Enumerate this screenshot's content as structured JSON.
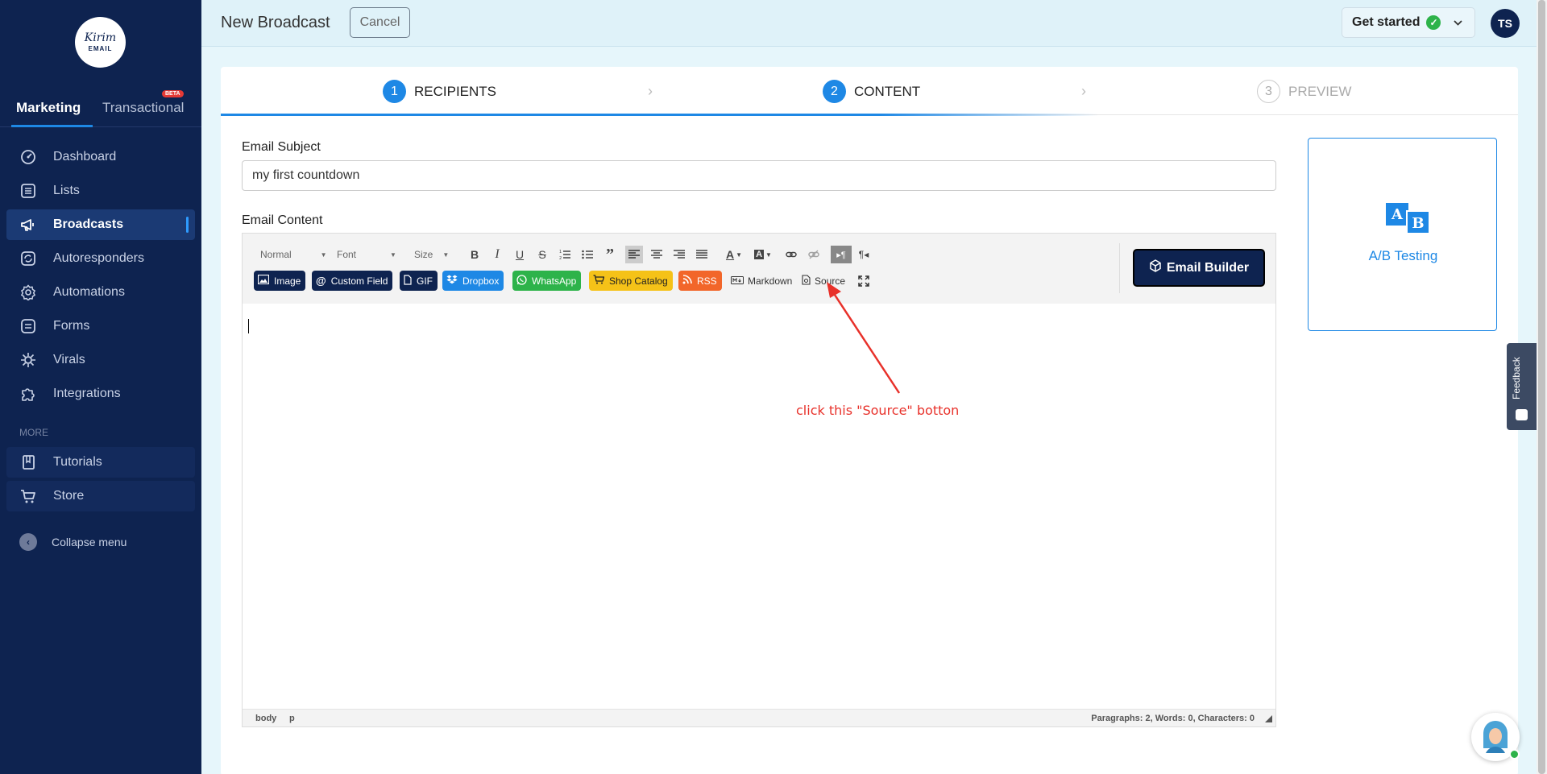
{
  "app": {
    "logo_line1": "Kirim",
    "logo_line2": "EMAIL"
  },
  "sidebar": {
    "tab_marketing": "Marketing",
    "tab_transactional": "Transactional",
    "beta_badge": "BETA",
    "items": [
      {
        "label": "Dashboard",
        "icon": "dashboard-icon"
      },
      {
        "label": "Lists",
        "icon": "list-icon"
      },
      {
        "label": "Broadcasts",
        "icon": "megaphone-icon"
      },
      {
        "label": "Autoresponders",
        "icon": "autoresponder-icon"
      },
      {
        "label": "Automations",
        "icon": "gear-icon"
      },
      {
        "label": "Forms",
        "icon": "form-icon"
      },
      {
        "label": "Virals",
        "icon": "virus-icon"
      },
      {
        "label": "Integrations",
        "icon": "puzzle-icon"
      }
    ],
    "more_label": "MORE",
    "more_items": [
      {
        "label": "Tutorials",
        "icon": "book-icon"
      },
      {
        "label": "Store",
        "icon": "cart-icon"
      }
    ],
    "collapse_label": "Collapse menu"
  },
  "topbar": {
    "title": "New Broadcast",
    "cancel_label": "Cancel",
    "get_started_label": "Get started",
    "avatar_initials": "TS"
  },
  "steps": [
    {
      "num": "1",
      "label": "RECIPIENTS",
      "state": "done"
    },
    {
      "num": "2",
      "label": "CONTENT",
      "state": "current"
    },
    {
      "num": "3",
      "label": "PREVIEW",
      "state": "todo"
    }
  ],
  "form": {
    "subject_label": "Email Subject",
    "subject_value": "my first countdown",
    "content_label": "Email Content"
  },
  "toolbar": {
    "format_select": "Normal",
    "font_select": "Font",
    "size_select": "Size",
    "chips": {
      "image": "Image",
      "custom_field": "Custom Field",
      "gif": "GIF",
      "dropbox": "Dropbox",
      "whatsapp": "WhatsApp",
      "shop_catalog": "Shop Catalog",
      "rss": "RSS"
    },
    "markdown_label": "Markdown",
    "source_label": "Source",
    "email_builder_label": "Email Builder"
  },
  "statusbar": {
    "path_body": "body",
    "path_p": "p",
    "counts": "Paragraphs: 2, Words: 0, Characters: 0"
  },
  "annotation": "click this \"Source\" botton",
  "ab_testing": {
    "label": "A/B Testing",
    "letter_a": "A",
    "letter_b": "B"
  },
  "feedback_label": "Feedback",
  "colors": {
    "sidebar_bg": "#0e2350",
    "accent": "#1e88e5",
    "annotation": "#e8312a"
  }
}
